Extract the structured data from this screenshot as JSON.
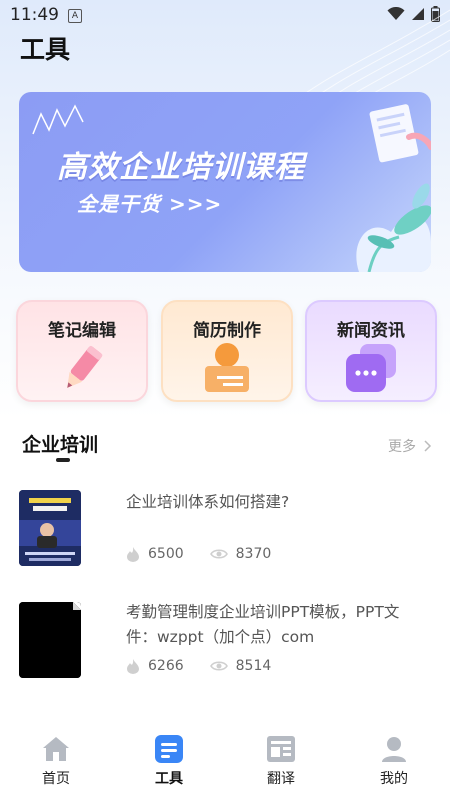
{
  "status_bar": {
    "time": "11:49",
    "notif_letter": "A"
  },
  "page": {
    "title": "工具"
  },
  "banner": {
    "title": "高效企业培训课程",
    "subtitle": "全是干货 >>>"
  },
  "tools": [
    {
      "label": "笔记编辑",
      "icon": "pen-icon"
    },
    {
      "label": "简历制作",
      "icon": "resume-icon"
    },
    {
      "label": "新闻资讯",
      "icon": "news-chat-icon"
    }
  ],
  "section": {
    "title": "企业培训",
    "more": "更多"
  },
  "articles": [
    {
      "title": "企业培训体系如何搭建?",
      "likes": "6500",
      "views": "8370"
    },
    {
      "title": "考勤管理制度企业培训PPT模板，PPT文件：wzppt（加个点）com",
      "likes": "6266",
      "views": "8514"
    }
  ],
  "tabs": [
    {
      "label": "首页",
      "icon": "home-icon",
      "active": false
    },
    {
      "label": "工具",
      "icon": "tools-icon",
      "active": true
    },
    {
      "label": "翻译",
      "icon": "translate-icon",
      "active": false
    },
    {
      "label": "我的",
      "icon": "profile-icon",
      "active": false
    }
  ],
  "colors": {
    "accent": "#3a86f6",
    "banner": "#8c9cf4",
    "tab_inactive": "#b5bac2"
  }
}
